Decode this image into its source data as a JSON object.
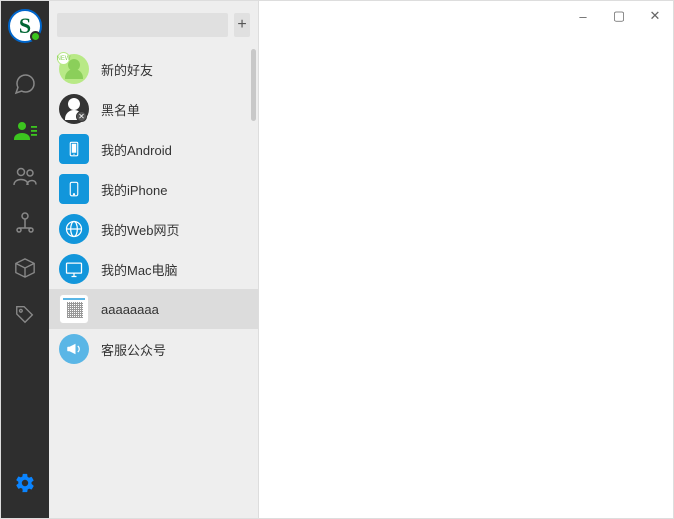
{
  "app": {
    "logo_letter": "S"
  },
  "search": {
    "placeholder": "",
    "value": "",
    "add_label": "+"
  },
  "nav": {
    "items": [
      {
        "name": "chat-icon",
        "active": false
      },
      {
        "name": "contacts-icon",
        "active": true
      },
      {
        "name": "group-icon",
        "active": false
      },
      {
        "name": "node-icon",
        "active": false
      },
      {
        "name": "box-icon",
        "active": false
      },
      {
        "name": "tag-icon",
        "active": false
      }
    ],
    "settings_name": "gear-icon"
  },
  "contacts": [
    {
      "label": "新的好友",
      "avatar_type": "new-friend",
      "selected": false
    },
    {
      "label": "黑名单",
      "avatar_type": "blacklist",
      "selected": false
    },
    {
      "label": "我的Android",
      "avatar_type": "android",
      "selected": false
    },
    {
      "label": "我的iPhone",
      "avatar_type": "iphone",
      "selected": false
    },
    {
      "label": "我的Web网页",
      "avatar_type": "web",
      "selected": false
    },
    {
      "label": "我的Mac电脑",
      "avatar_type": "mac",
      "selected": false
    },
    {
      "label": "aaaaaaaa",
      "avatar_type": "qr",
      "selected": true
    },
    {
      "label": "客服公众号",
      "avatar_type": "horn",
      "selected": false
    }
  ],
  "window_controls": {
    "minimize": "–",
    "maximize": "▢",
    "close": "✕"
  }
}
